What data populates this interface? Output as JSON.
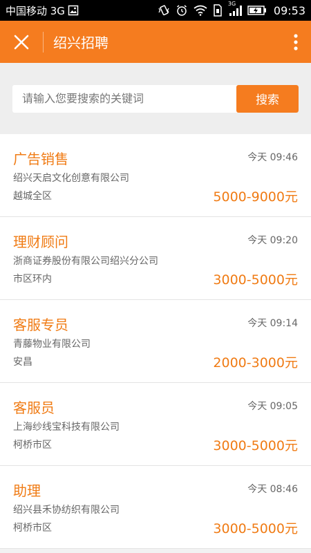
{
  "status_bar": {
    "carrier": "中国移动 3G",
    "network": "3G",
    "time": "09:53"
  },
  "app_bar": {
    "title": "绍兴招聘"
  },
  "search": {
    "placeholder": "请输入您要搜索的关键词",
    "button_label": "搜索"
  },
  "jobs": [
    {
      "title": "广告销售",
      "company": "绍兴天启文化创意有限公司",
      "location": "越城全区",
      "time": "今天 09:46",
      "salary": "5000-9000元"
    },
    {
      "title": "理财顾问",
      "company": "浙商证券股份有限公司绍兴分公司",
      "location": "市区环内",
      "time": "今天 09:20",
      "salary": "3000-5000元"
    },
    {
      "title": "客服专员",
      "company": "青藤物业有限公司",
      "location": "安昌",
      "time": "今天 09:14",
      "salary": "2000-3000元"
    },
    {
      "title": "客服员",
      "company": "上海纱线宝科技有限公司",
      "location": "柯桥市区",
      "time": "今天 09:05",
      "salary": "3000-5000元"
    },
    {
      "title": "助理",
      "company": "绍兴县禾协纺织有限公司",
      "location": "柯桥市区",
      "time": "今天 08:46",
      "salary": "3000-5000元"
    }
  ],
  "colors": {
    "accent": "#f57c1f",
    "text_accent": "#f07b14",
    "status_bar": "#000000"
  }
}
